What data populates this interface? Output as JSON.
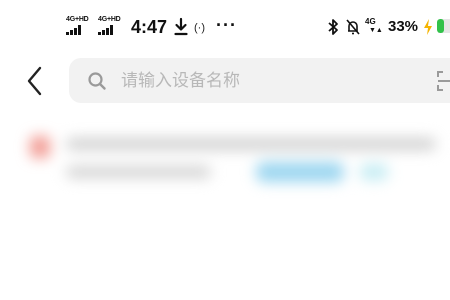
{
  "status_bar": {
    "sim1_label": "4G+HD",
    "sim2_label": "4G+HD",
    "time": "4:47",
    "download_icon": "download-icon",
    "hotspot_icon": "hotspot-icon",
    "hotspot_glyph": "(·)",
    "more": "···",
    "bluetooth_icon": "bluetooth-icon",
    "mute_icon": "mute-icon",
    "network_label": "4G",
    "battery_percent": "33%",
    "battery_level": 0.33,
    "battery_color": "#32c24a"
  },
  "header": {
    "back_icon": "chevron-left-icon",
    "search": {
      "placeholder": "请输入设备名称",
      "value": "",
      "search_icon": "search-icon",
      "scan_icon": "scan-icon"
    }
  },
  "results": {
    "blurred_placeholder_count": 1
  }
}
